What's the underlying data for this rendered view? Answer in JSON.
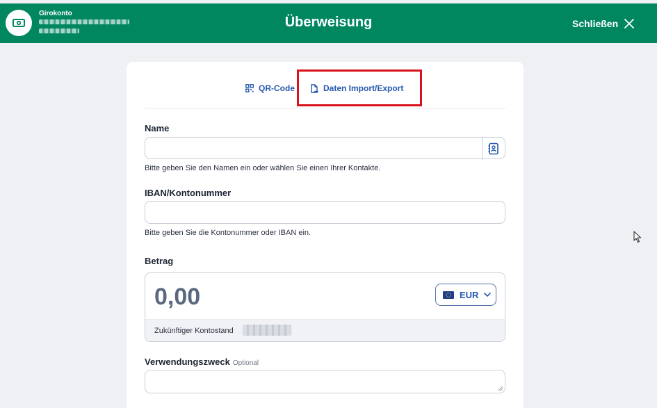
{
  "header": {
    "account_name": "Girokonto",
    "title": "Überweisung",
    "close_label": "Schließen"
  },
  "tabs": [
    {
      "label": "QR-Code",
      "icon": "qr-code-icon"
    },
    {
      "label": "Daten Import/Export",
      "icon": "file-import-icon"
    }
  ],
  "form": {
    "name": {
      "label": "Name",
      "value": "",
      "helper": "Bitte geben Sie den Namen ein oder wählen Sie einen Ihrer Kontakte."
    },
    "iban": {
      "label": "IBAN/Kontonummer",
      "value": "",
      "helper": "Bitte geben Sie die Kontonummer oder IBAN ein."
    },
    "amount": {
      "label": "Betrag",
      "value": "0,00",
      "currency": "EUR",
      "future_balance_label": "Zukünftiger Kontostand"
    },
    "purpose": {
      "label": "Verwendungszweck",
      "optional_label": "Optional",
      "value": ""
    }
  },
  "colors": {
    "brand_green": "#008760",
    "accent_blue": "#2558b0",
    "highlight_red": "#d9111a"
  }
}
